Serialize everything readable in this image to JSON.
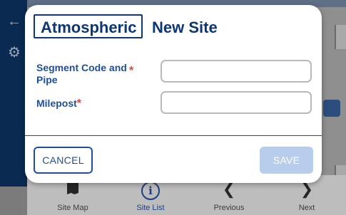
{
  "background": {
    "nav": [
      {
        "label": "Site Map",
        "icon": "map-icon"
      },
      {
        "label": "Site List",
        "icon": "info-icon"
      },
      {
        "label": "Previous",
        "icon": "chevron-left-icon"
      },
      {
        "label": "Next",
        "icon": "chevron-right-icon"
      }
    ]
  },
  "modal": {
    "brand": "Atmospheric",
    "title": "New Site",
    "fields": [
      {
        "label": "Segment Code and Pipe",
        "required_mark": "*",
        "value": "",
        "placeholder": ""
      },
      {
        "label": "Milepost",
        "required_mark": "*",
        "value": "",
        "placeholder": ""
      }
    ],
    "cancel_label": "CANCEL",
    "save_label": "SAVE"
  },
  "colors": {
    "brand_blue": "#0d3673",
    "label_blue": "#1d4f9a",
    "required_red": "#e0403a",
    "save_disabled": "#b8cdeb"
  }
}
